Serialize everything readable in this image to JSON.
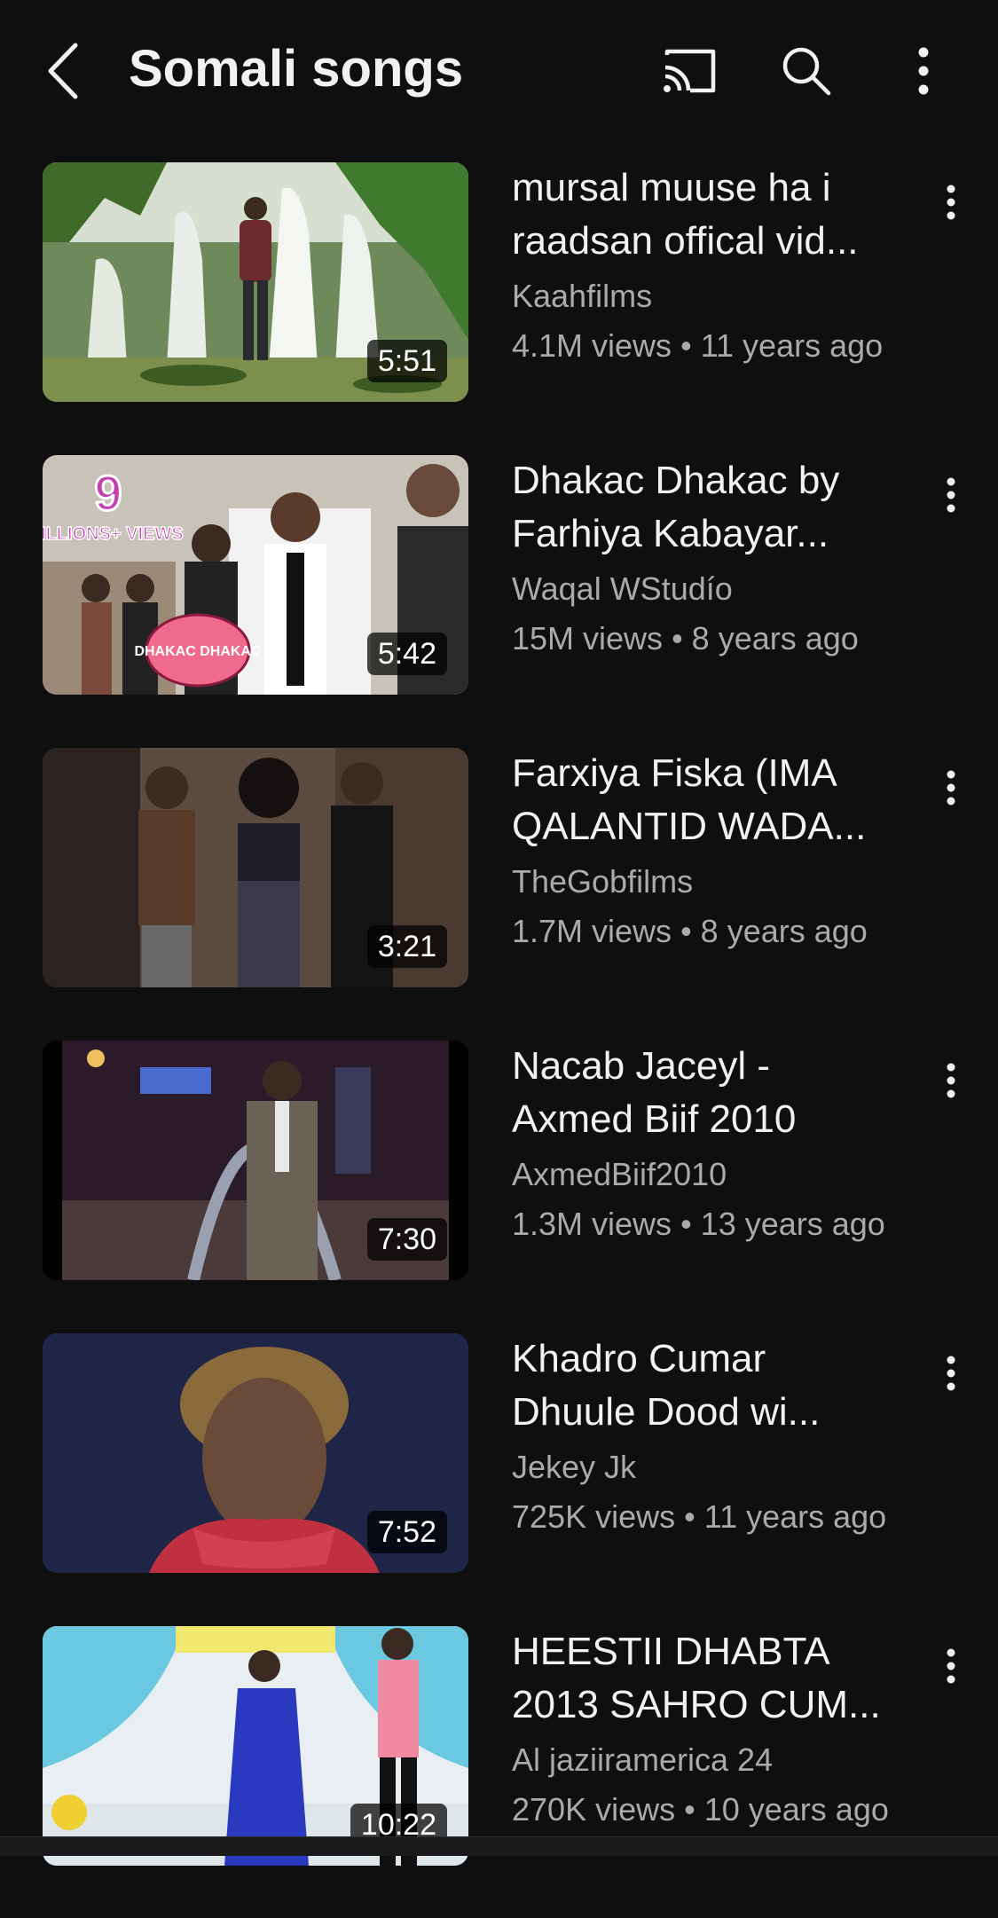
{
  "header": {
    "title": "Somali songs",
    "icons": [
      "back-arrow-icon",
      "cast-icon",
      "search-icon",
      "more-vertical-icon"
    ]
  },
  "videos": [
    {
      "title_line1": "mursal muuse ha i",
      "title_line2": "raadsan offical vid...",
      "channel": "Kaahfilms",
      "views": "4.1M views",
      "age": "11 years ago",
      "duration": "5:51"
    },
    {
      "title_line1": "Dhakac Dhakac by",
      "title_line2": "Farhiya Kabayar...",
      "channel": "Waqal WStudío",
      "views": "15M views",
      "age": "8 years ago",
      "duration": "5:42",
      "badge_number": "9",
      "badge_text": "MILLIONS+ VIEWS",
      "bubble_text": "DHAKAC DHAKAC"
    },
    {
      "title_line1": "Farxiya Fiska (IMA",
      "title_line2": "QALANTID WADA...",
      "channel": "TheGobfilms",
      "views": "1.7M views",
      "age": "8 years ago",
      "duration": "3:21"
    },
    {
      "title_line1": "Nacab Jaceyl -",
      "title_line2": "Axmed Biif 2010",
      "channel": "AxmedBiif2010",
      "views": "1.3M views",
      "age": "13 years ago",
      "duration": "7:30"
    },
    {
      "title_line1": "Khadro Cumar",
      "title_line2": "Dhuule Dood wi...",
      "channel": "Jekey Jk",
      "views": "725K views",
      "age": "11 years ago",
      "duration": "7:52"
    },
    {
      "title_line1": "HEESTII DHABTA",
      "title_line2": "2013 SAHRO CUM...",
      "channel": "Al jaziiramerica 24",
      "views": "270K views",
      "age": "10 years ago",
      "duration": "10:22"
    }
  ],
  "separator": "•",
  "colors": {
    "background": "#0f0f0f",
    "text_primary": "#f1f1f1",
    "text_secondary": "#aaaaaa"
  }
}
